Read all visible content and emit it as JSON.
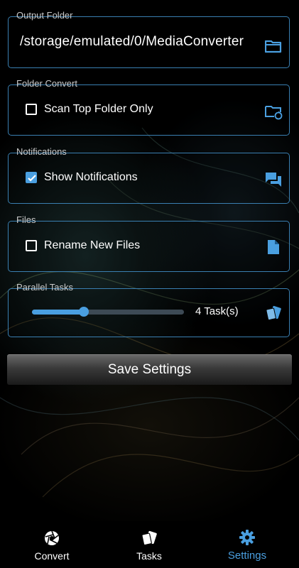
{
  "output_folder": {
    "legend": "Output Folder",
    "path": "/storage/emulated/0/MediaConverter",
    "icon": "folder-icon"
  },
  "folder_convert": {
    "legend": "Folder Convert",
    "option_label": "Scan Top Folder Only",
    "checked": false,
    "icon": "folder-sync-icon"
  },
  "notifications": {
    "legend": "Notifications",
    "option_label": "Show Notifications",
    "checked": true,
    "icon": "chat-bubbles-icon"
  },
  "files": {
    "legend": "Files",
    "option_label": "Rename New Files",
    "checked": false,
    "icon": "file-icon"
  },
  "parallel_tasks": {
    "legend": "Parallel Tasks",
    "value_label": "4 Task(s)",
    "slider_fraction": 0.34,
    "icon": "cards-icon"
  },
  "save_button": {
    "label": "Save Settings"
  },
  "bottom_nav": {
    "items": [
      {
        "label": "Convert",
        "icon": "aperture-icon",
        "active": false
      },
      {
        "label": "Tasks",
        "icon": "cards-icon",
        "active": false
      },
      {
        "label": "Settings",
        "icon": "gear-icon",
        "active": true
      }
    ]
  },
  "colors": {
    "accent": "#4a9fe0",
    "border": "#3a7fb1",
    "background": "#000000"
  }
}
